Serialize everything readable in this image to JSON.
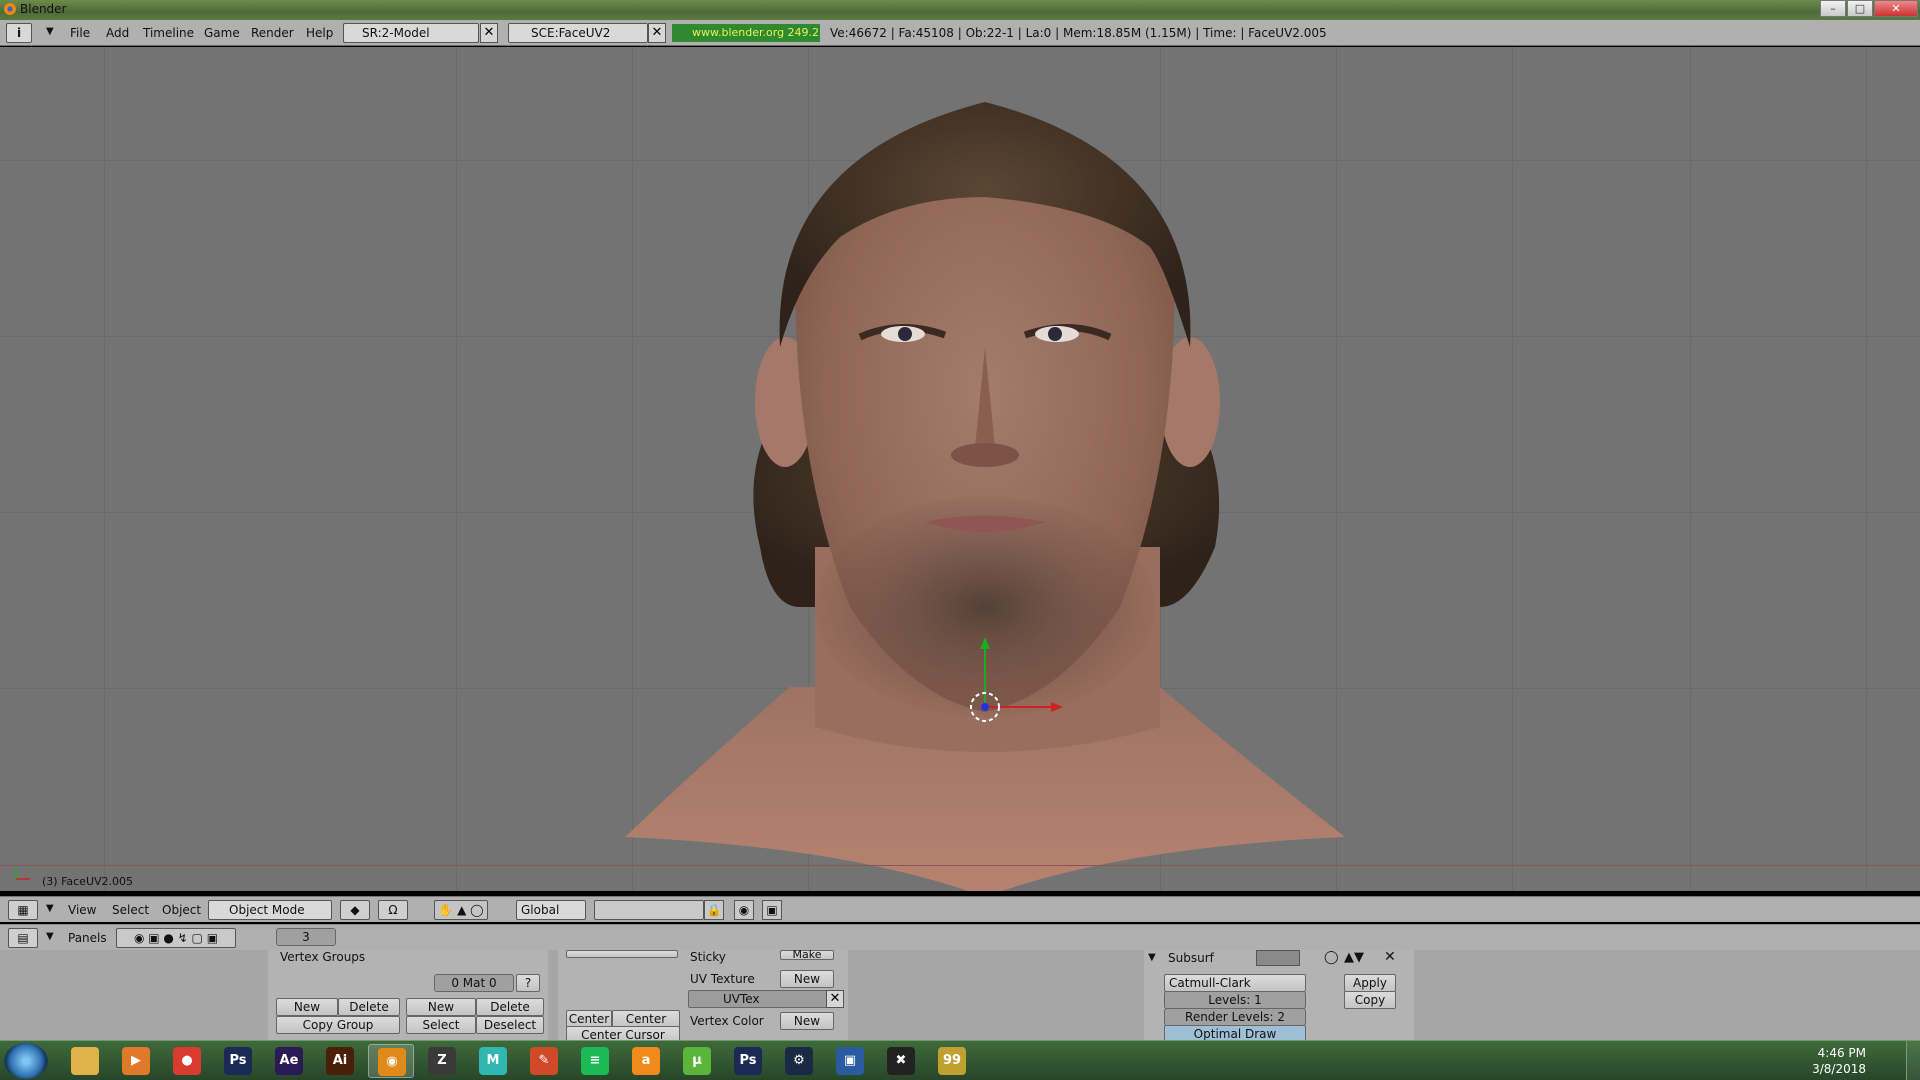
{
  "window": {
    "title": "Blender",
    "controls": {
      "minimize": "–",
      "maximize": "□",
      "close": "✕"
    }
  },
  "infobar": {
    "menu": [
      "File",
      "Add",
      "Timeline",
      "Game",
      "Render",
      "Help"
    ],
    "screen_field": "SR:2-Model",
    "scene_field": "SCE:FaceUV2",
    "url": "www.blender.org 249.2",
    "stats": "Ve:46672 | Fa:45108 | Ob:22-1 | La:0  | Mem:18.85M (1.15M)  | Time: | FaceUV2.005"
  },
  "viewport": {
    "object_label": "(3) FaceUV2.005"
  },
  "viewport_header": {
    "menu": [
      "View",
      "Select",
      "Object"
    ],
    "mode": "Object Mode",
    "orientation": "Global"
  },
  "buttons_header": {
    "label": "Panels",
    "frame": "3"
  },
  "panels": {
    "link_materials": {
      "vertex_groups_label": "Vertex Groups",
      "mat_field": "0 Mat 0",
      "help": "?",
      "new": "New",
      "delete": "Delete",
      "copy_group": "Copy Group",
      "new2": "New",
      "delete2": "Delete",
      "select": "Select",
      "deselect": "Deselect"
    },
    "mesh": {
      "center": "Center",
      "center_new": "Center New",
      "center_cursor": "Center Cursor",
      "sticky": "Sticky",
      "make": "Make",
      "uv_texture": "UV Texture",
      "uv_new": "New",
      "uvtex_name": "UVTex",
      "vertex_color": "Vertex Color",
      "vc_new": "New"
    },
    "modifiers": {
      "name": "Subsurf",
      "type": "Catmull-Clark",
      "levels": "Levels: 1",
      "render_levels": "Render Levels: 2",
      "optimal_draw": "Optimal Draw",
      "apply": "Apply",
      "copy": "Copy"
    }
  },
  "taskbar": {
    "apps": [
      {
        "name": "explorer-icon",
        "color": "#e0b24a",
        "glyph": ""
      },
      {
        "name": "media-player-icon",
        "color": "#e07a2a",
        "glyph": "▶"
      },
      {
        "name": "chrome-icon",
        "color": "#d83b2f",
        "glyph": "●"
      },
      {
        "name": "photoshop-icon",
        "color": "#1b2a55",
        "glyph": "Ps"
      },
      {
        "name": "after-effects-icon",
        "color": "#2a1a55",
        "glyph": "Ae"
      },
      {
        "name": "illustrator-icon",
        "color": "#4a1f0a",
        "glyph": "Ai"
      },
      {
        "name": "blender-icon",
        "color": "#e08a1a",
        "glyph": "◉"
      },
      {
        "name": "zbrush-icon",
        "color": "#3a3a3a",
        "glyph": "Z"
      },
      {
        "name": "maya-icon",
        "color": "#2fb7b0",
        "glyph": "M"
      },
      {
        "name": "pencil-icon",
        "color": "#d04a2a",
        "glyph": "✎"
      },
      {
        "name": "spotify-icon",
        "color": "#1db954",
        "glyph": "≡"
      },
      {
        "name": "amazon-icon",
        "color": "#f08a1a",
        "glyph": "a"
      },
      {
        "name": "utorrent-icon",
        "color": "#5ab53a",
        "glyph": "µ"
      },
      {
        "name": "photoshop2-icon",
        "color": "#1b2a55",
        "glyph": "Ps"
      },
      {
        "name": "steam-icon",
        "color": "#1b2a44",
        "glyph": "⚙"
      },
      {
        "name": "virtualbox-icon",
        "color": "#2a5aa0",
        "glyph": "▣"
      },
      {
        "name": "xbox-tool-icon",
        "color": "#222222",
        "glyph": "✖"
      },
      {
        "name": "network-tool-icon",
        "color": "#c0a030",
        "glyph": "99"
      }
    ],
    "time": "4:46 PM",
    "date": "3/8/2018"
  }
}
